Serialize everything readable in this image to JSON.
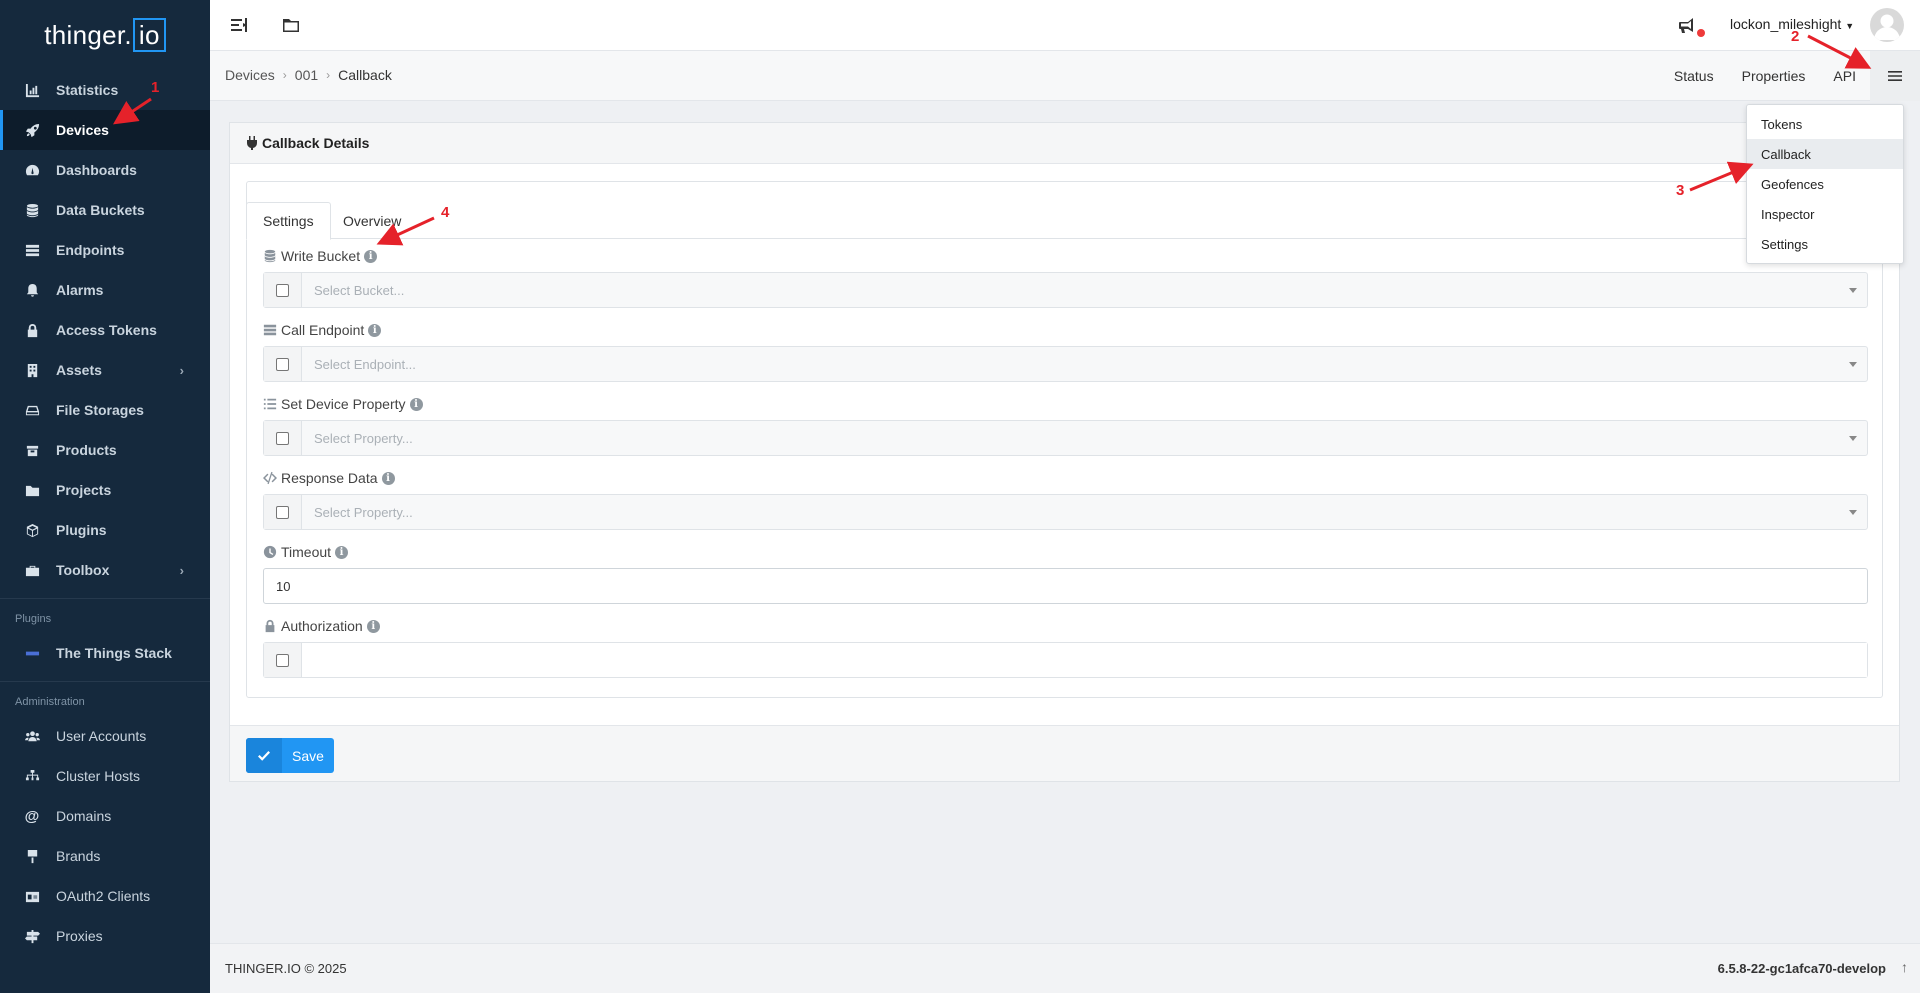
{
  "app": {
    "logo_text": "thinger.",
    "logo_box": "io",
    "accent_color": "#2196f3"
  },
  "sidebar": {
    "items": [
      {
        "label": "Statistics",
        "icon": "chart-icon"
      },
      {
        "label": "Devices",
        "icon": "rocket-icon",
        "active": true
      },
      {
        "label": "Dashboards",
        "icon": "gauge-icon"
      },
      {
        "label": "Data Buckets",
        "icon": "database-icon"
      },
      {
        "label": "Endpoints",
        "icon": "server-icon"
      },
      {
        "label": "Alarms",
        "icon": "bell-icon"
      },
      {
        "label": "Access Tokens",
        "icon": "lock-icon"
      },
      {
        "label": "Assets",
        "icon": "building-icon",
        "chevron": true
      },
      {
        "label": "File Storages",
        "icon": "hdd-icon"
      },
      {
        "label": "Products",
        "icon": "box-icon"
      },
      {
        "label": "Projects",
        "icon": "folder-icon"
      },
      {
        "label": "Plugins",
        "icon": "cube-icon"
      },
      {
        "label": "Toolbox",
        "icon": "toolbox-icon",
        "chevron": true
      }
    ],
    "plugins_section": "Plugins",
    "plugins": [
      {
        "label": "The Things Stack"
      }
    ],
    "admin_section": "Administration",
    "admin_items": [
      {
        "label": "User Accounts"
      },
      {
        "label": "Cluster Hosts"
      },
      {
        "label": "Domains"
      },
      {
        "label": "Brands"
      },
      {
        "label": "OAuth2 Clients"
      },
      {
        "label": "Proxies"
      }
    ]
  },
  "topbar": {
    "username": "lockon_mileshight"
  },
  "breadcrumb": {
    "items": [
      "Devices",
      "001",
      "Callback"
    ],
    "tabs": [
      "Status",
      "Properties",
      "API"
    ]
  },
  "dropdown": {
    "items": [
      "Tokens",
      "Callback",
      "Geofences",
      "Inspector",
      "Settings"
    ],
    "highlighted": "Callback"
  },
  "card": {
    "title": "Callback Details",
    "tabs": [
      "Settings",
      "Overview"
    ],
    "fields": {
      "write_bucket": {
        "label": "Write Bucket",
        "placeholder": "Select Bucket..."
      },
      "call_endpoint": {
        "label": "Call Endpoint",
        "placeholder": "Select Endpoint..."
      },
      "set_property": {
        "label": "Set Device Property",
        "placeholder": "Select Property..."
      },
      "response_data": {
        "label": "Response Data",
        "placeholder": "Select Property..."
      },
      "timeout": {
        "label": "Timeout",
        "value": "10"
      },
      "authorization": {
        "label": "Authorization",
        "value": ""
      }
    },
    "save_label": "Save"
  },
  "footer": {
    "copyright": "THINGER.IO © 2025",
    "version": "6.5.8-22-gc1afca70-develop"
  },
  "annotations": [
    "1",
    "2",
    "3",
    "4"
  ]
}
